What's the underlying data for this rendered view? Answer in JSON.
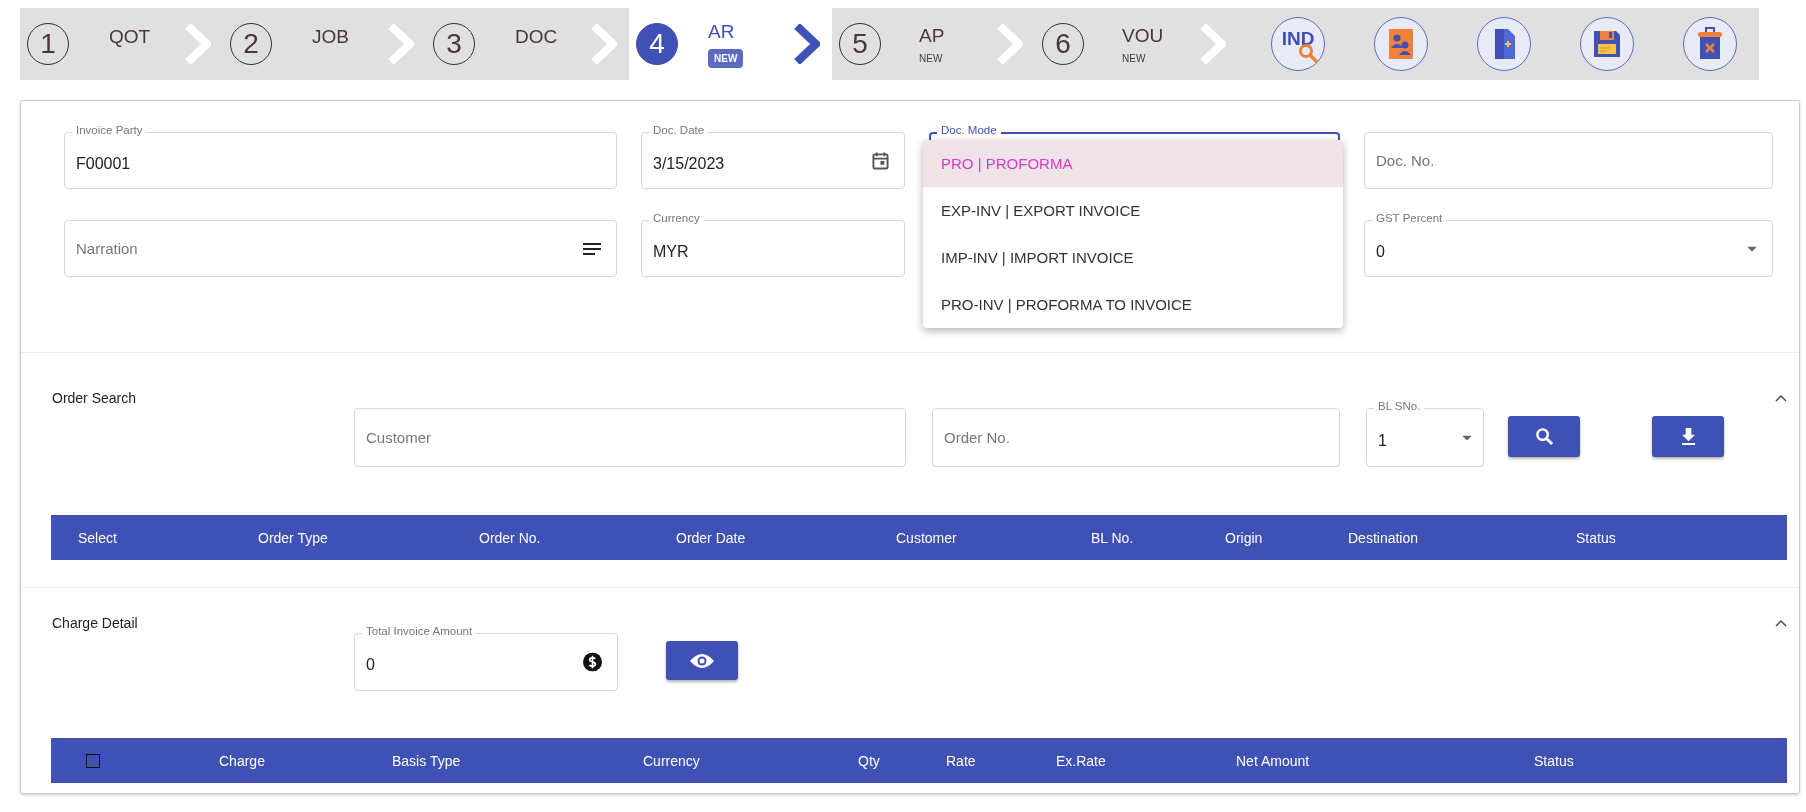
{
  "steps": [
    {
      "number": "1",
      "label": "QOT",
      "selected": false
    },
    {
      "number": "2",
      "label": "JOB",
      "selected": false
    },
    {
      "number": "3",
      "label": "DOC",
      "selected": false
    },
    {
      "number": "4",
      "label": "AR",
      "badge": "NEW",
      "selected": true
    },
    {
      "number": "5",
      "label": "AP",
      "badge": "NEW",
      "selected": false
    },
    {
      "number": "6",
      "label": "VOU",
      "badge": "NEW",
      "selected": false
    }
  ],
  "toolbar": [
    {
      "kind": "index-search",
      "text": "IND"
    },
    {
      "kind": "contacts"
    },
    {
      "kind": "new-document"
    },
    {
      "kind": "save"
    },
    {
      "kind": "delete"
    }
  ],
  "header_fields": [
    [
      {
        "kind": "text",
        "label": "Invoice Party",
        "value": "F00001"
      },
      {
        "kind": "date",
        "label": "Doc. Date",
        "value": "3/15/2023"
      },
      {
        "kind": "select",
        "label": "Doc. Mode",
        "focused": true,
        "options": [
          {
            "label": "PRO | PROFORMA",
            "selected": true
          },
          {
            "label": "EXP-INV | EXPORT INVOICE",
            "selected": false
          },
          {
            "label": "IMP-INV | IMPORT INVOICE",
            "selected": false
          },
          {
            "label": "PRO-INV | PROFORMA TO INVOICE",
            "selected": false
          }
        ]
      },
      {
        "kind": "text",
        "placeholder": "Doc. No."
      }
    ],
    [
      {
        "kind": "textarea",
        "placeholder": "Narration"
      },
      {
        "kind": "text",
        "label": "Currency",
        "value": "MYR"
      },
      {
        "kind": "select",
        "label": "GST Percent",
        "value": "0"
      }
    ]
  ],
  "order_search": {
    "title": "Order Search",
    "expanded": true,
    "customer": {
      "placeholder": "Customer"
    },
    "order_no": {
      "placeholder": "Order No."
    },
    "bl_sno": {
      "label": "BL SNo.",
      "value": "1"
    },
    "columns": [
      "Select",
      "Order Type",
      "Order No.",
      "Order Date",
      "Customer",
      "BL No.",
      "Origin",
      "Destination",
      "Status"
    ]
  },
  "charge_detail": {
    "title": "Charge Detail",
    "expanded": true,
    "total": {
      "label": "Total Invoice Amount",
      "value": "0"
    },
    "select_all": {
      "checked": false
    },
    "columns": [
      "Charge",
      "Basis Type",
      "Currency",
      "Qty",
      "Rate",
      "Ex.Rate",
      "Net Amount",
      "Status"
    ]
  }
}
